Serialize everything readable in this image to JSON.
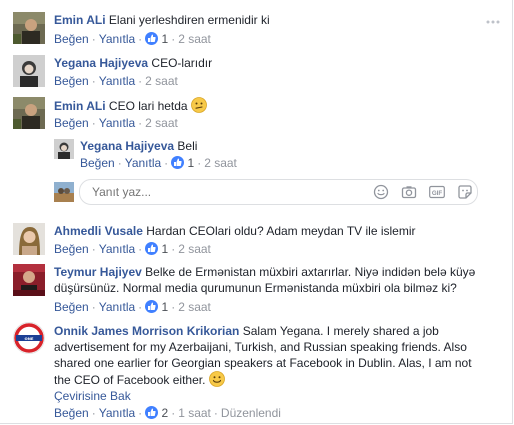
{
  "comments": [
    {
      "author": "Emin ALi",
      "text": "Elani yerleshdiren ermenidir ki",
      "like_label": "Beğen",
      "reply_label": "Yanıtla",
      "reactions": "1",
      "time": "2 saat"
    },
    {
      "author": "Yegana Hajiyeva",
      "text": "CEO-larıdır",
      "like_label": "Beğen",
      "reply_label": "Yanıtla",
      "time": "2 saat"
    },
    {
      "author": "Emin ALi",
      "text": "CEO lari hetda",
      "like_label": "Beğen",
      "reply_label": "Yanıtla",
      "time": "2 saat"
    },
    {
      "author": "Yegana Hajiyeva",
      "text": "Beli",
      "like_label": "Beğen",
      "reply_label": "Yanıtla",
      "reactions": "1",
      "time": "2 saat"
    },
    {
      "author": "Ahmedli Vusale",
      "text": "Hardan CEOlari oldu? Adam meydan TV ile islemir",
      "like_label": "Beğen",
      "reply_label": "Yanıtla",
      "reactions": "1",
      "time": "2 saat"
    },
    {
      "author": "Teymur Hajiyev",
      "text": "Belke de Ermənistan müxbiri axtarırlar. Niyə indidən belə küyə düşürsünüz. Normal media qurumunun Ermənistanda müxbiri ola bilməz ki?",
      "line1": "Belke de Ermənistan müxbiri axtarırlar. Niyə indidən belə küyə",
      "line2": "düşürsünüz. Normal media qurumunun Ermənistanda müxbiri ola bilməz ki?",
      "like_label": "Beğen",
      "reply_label": "Yanıtla",
      "reactions": "1",
      "time": "2 saat"
    },
    {
      "author": "Onnik James Morrison Krikorian",
      "line1": "Salam Yegana. I merely shared a job",
      "line2": "advertisement for my Azerbaijani, Turkish, and Russian speaking friends. Also",
      "line3": "shared one earlier for Georgian speakers at Facebook in Dublin. Alas, I am not",
      "line4": "the CEO of Facebook either.",
      "translate_label": "Çevirisine Bak",
      "like_label": "Beğen",
      "reply_label": "Yanıtla",
      "reactions": "2",
      "time": "1 saat",
      "edited_label": "Düzenlendi"
    }
  ],
  "reply_box": {
    "placeholder": "Yanıt yaz..."
  },
  "colors": {
    "link": "#365899",
    "like_blue": "#4080ff",
    "meta_gray": "#90949c"
  },
  "icons": [
    "more-options-icon",
    "like-icon",
    "neutral-face-emoji-icon",
    "emoji-icon",
    "camera-icon",
    "gif-icon",
    "sticker-icon",
    "smile-emoji-icon"
  ]
}
